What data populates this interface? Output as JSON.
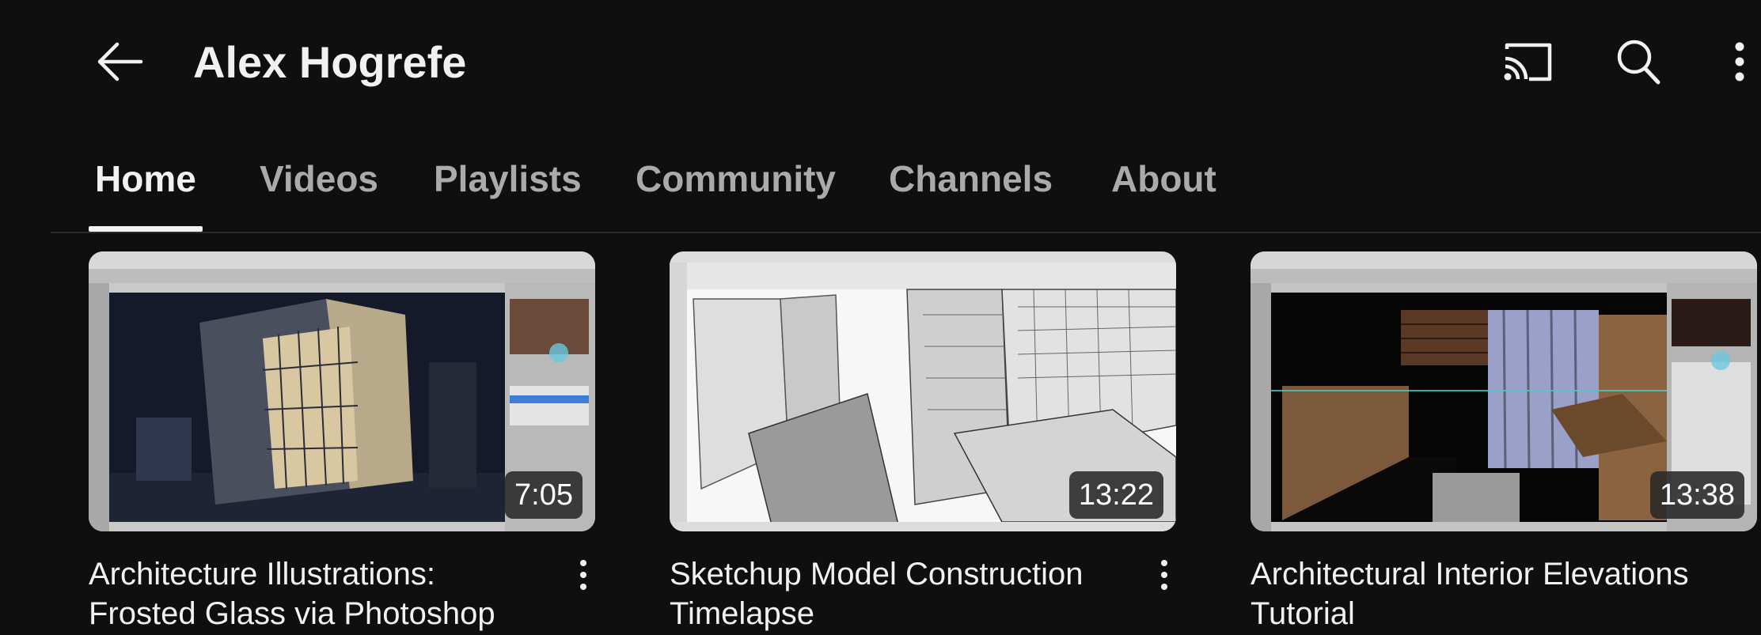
{
  "header": {
    "title": "Alex Hogrefe",
    "back_icon": "arrow-left-icon",
    "cast_icon": "cast-icon",
    "search_icon": "search-icon",
    "more_icon": "more-vertical-icon"
  },
  "tabs": [
    {
      "label": "Home",
      "active": true
    },
    {
      "label": "Videos",
      "active": false
    },
    {
      "label": "Playlists",
      "active": false
    },
    {
      "label": "Community",
      "active": false
    },
    {
      "label": "Channels",
      "active": false
    },
    {
      "label": "About",
      "active": false
    }
  ],
  "videos": [
    {
      "title": "Architecture Illustrations: Frosted Glass via Photoshop",
      "duration": "7:05"
    },
    {
      "title": "Sketchup Model Construction Timelapse",
      "duration": "13:22"
    },
    {
      "title": "Architectural Interior Elevations Tutorial",
      "duration": "13:38"
    }
  ],
  "colors": {
    "background": "#0f0f0f",
    "text_primary": "#f1f1f1",
    "text_secondary": "#aaaaaa"
  }
}
